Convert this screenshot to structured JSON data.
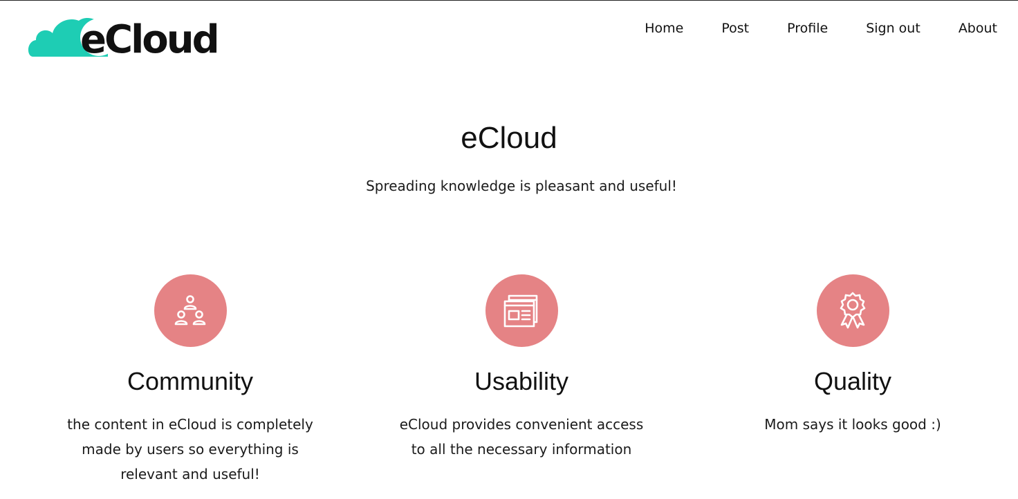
{
  "brand": {
    "logo_text": "eCloud",
    "accent_color": "#1ecdb4"
  },
  "nav": {
    "items": [
      {
        "label": "Home"
      },
      {
        "label": "Post"
      },
      {
        "label": "Profile"
      },
      {
        "label": "Sign out"
      },
      {
        "label": "About"
      }
    ]
  },
  "hero": {
    "title": "eCloud",
    "subtitle": "Spreading knowledge is pleasant and useful!"
  },
  "features": [
    {
      "icon": "community-icon",
      "title": "Community",
      "line1": "the content in eCloud is completely",
      "line2": "made by users so everything is",
      "line3": "relevant and useful!"
    },
    {
      "icon": "newspaper-icon",
      "title": "Usability",
      "line1": "eCloud provides convenient access",
      "line2": "to all the necessary information",
      "line3": ""
    },
    {
      "icon": "award-ribbon-icon",
      "title": "Quality",
      "line1": "Mom says it looks good :)",
      "line2": "",
      "line3": ""
    }
  ],
  "colors": {
    "icon_circle": "#e58385",
    "text": "#111111"
  }
}
